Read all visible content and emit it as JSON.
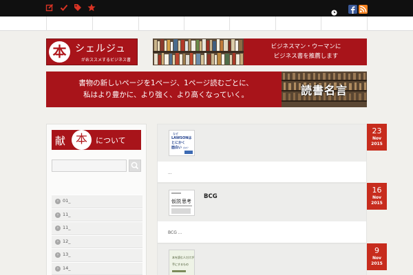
{
  "topbar": {
    "icons": [
      "edit-icon",
      "check-icon",
      "tag-icon",
      "star-icon"
    ],
    "accent": "#d93324",
    "background": "#101010",
    "social": [
      "clock-icon",
      "facebook-icon",
      "rss-icon"
    ]
  },
  "header": {
    "logo": {
      "mark": "本",
      "title": "シェルジュ",
      "subtitle": "がおススメするビジネス書"
    },
    "banner": {
      "line1": "ビジネスマン・ウーマンに",
      "line2": "ビジネス書を推薦します"
    },
    "quote": {
      "line1": "書物の新しいページを1ページ、1ページ読むごとに、",
      "line2": "私はより豊かに、より強く、より高くなっていく。",
      "label": "読書名言"
    },
    "brand_color": "#a8141a"
  },
  "sidebar": {
    "header": {
      "left": "献",
      "mark": "本",
      "right": "について"
    },
    "search_value": "",
    "archive": [
      "01_",
      "11_",
      "11_",
      "12_",
      "13_",
      "14_"
    ]
  },
  "posts": [
    {
      "day": "23",
      "month": "Nov",
      "year": "2015",
      "title": "",
      "excerpt": "...",
      "thumb": {
        "line1": "なぜ",
        "line2": "LAWSONは",
        "line3": "とにかく",
        "line4": "面白い",
        "line5": "のか？"
      }
    },
    {
      "day": "16",
      "month": "Nov",
      "year": "2015",
      "title": "BCG",
      "excerpt": "BCG ...",
      "thumb": {
        "line1": "仮説",
        "line2": "思考"
      }
    },
    {
      "day": "9",
      "month": "Nov",
      "year": "2015",
      "title": "",
      "excerpt": "",
      "thumb": {
        "line1": "本を読む人だけが",
        "line2": "手にするもの"
      }
    }
  ],
  "date_color": "#c72c1d"
}
